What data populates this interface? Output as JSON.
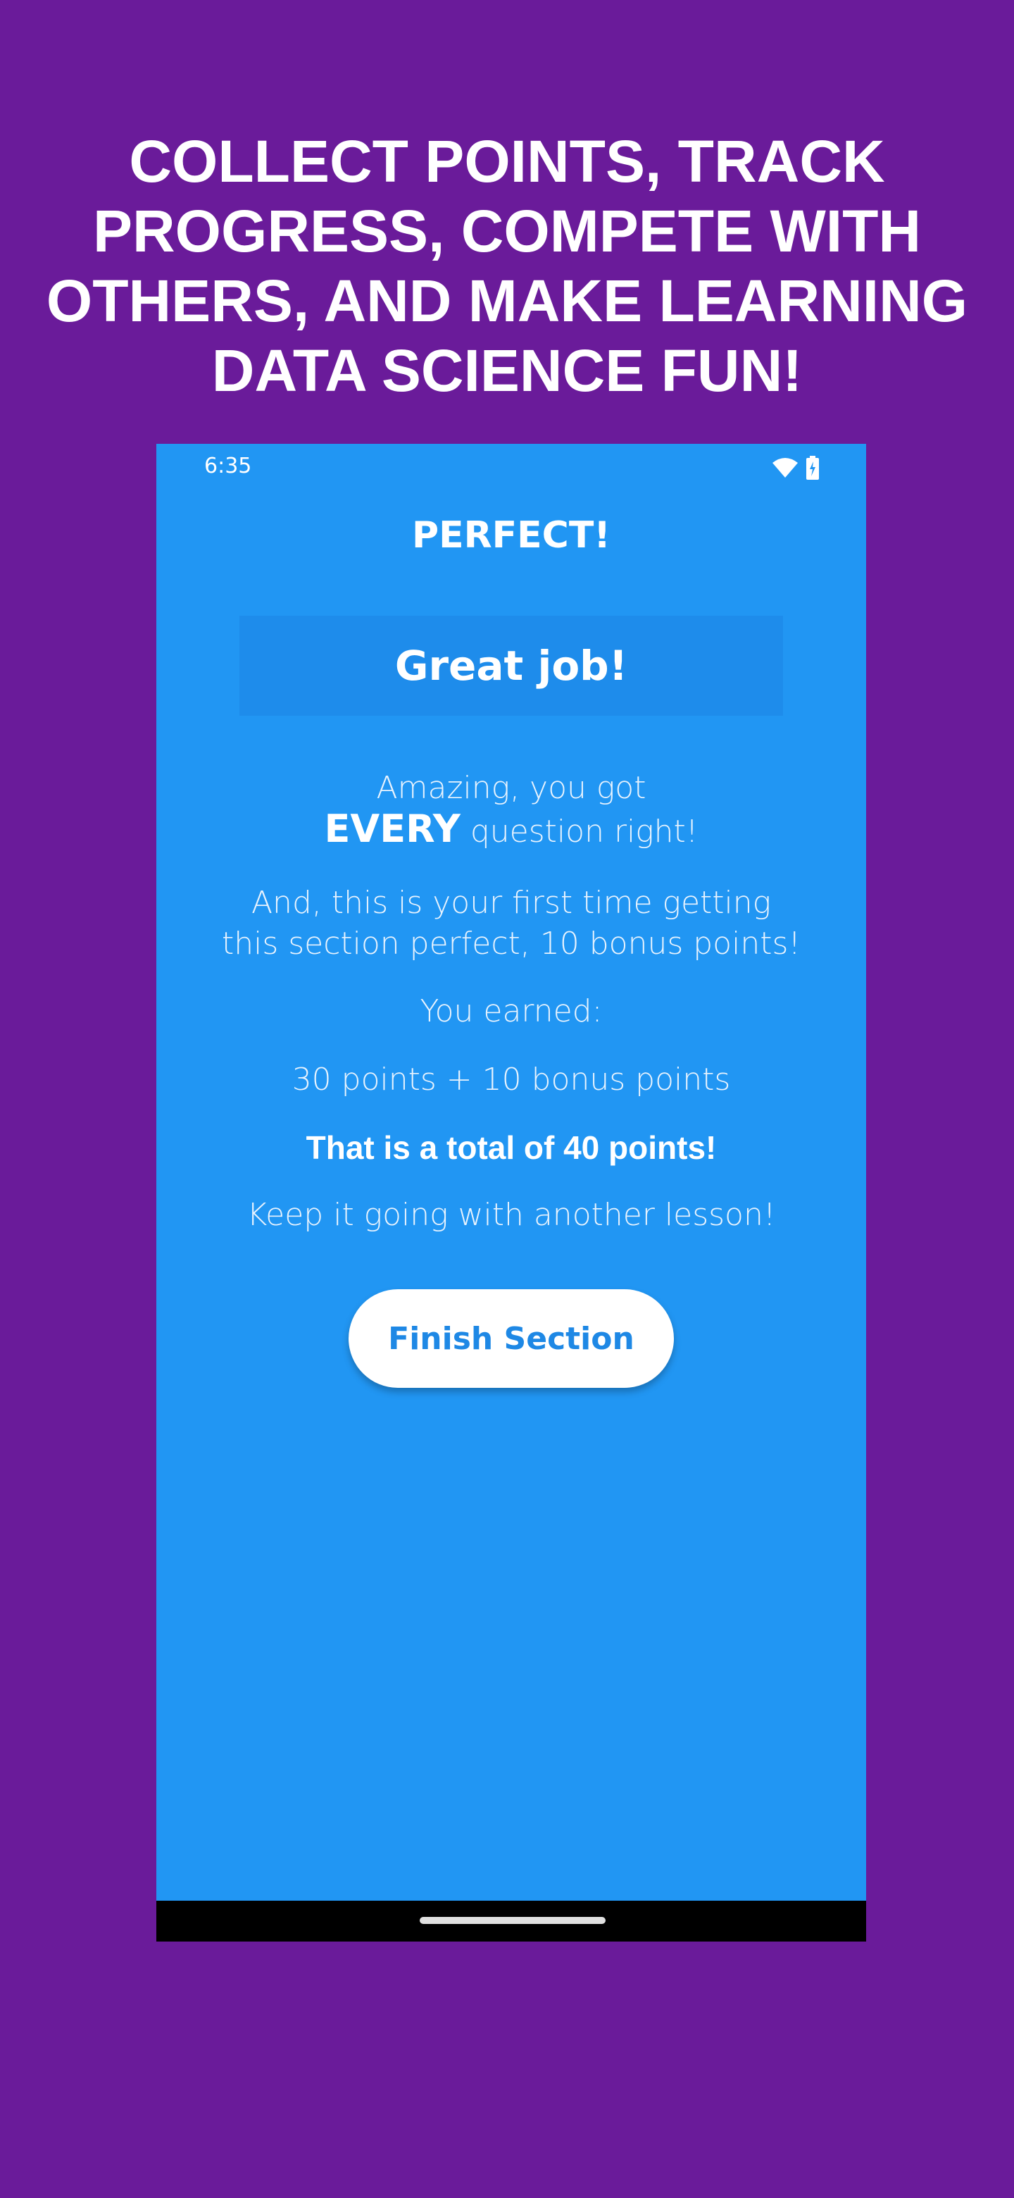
{
  "promo": {
    "headline_lines": [
      "COLLECT POINTS, TRACK",
      "PROGRESS, COMPETE WITH",
      "OTHERS, AND MAKE LEARNING",
      "DATA SCIENCE FUN!"
    ]
  },
  "status_bar": {
    "time": "6:35",
    "icons": [
      "wifi-icon",
      "battery-charging-icon"
    ]
  },
  "screen": {
    "title": "PERFECT!",
    "banner": "Great job!",
    "message": {
      "line1": "Amazing, you got",
      "line2_bold": "EVERY",
      "line2_rest": "question right!"
    },
    "bonus": {
      "line1": "And, this is your first time getting",
      "line2": "this section perfect, 10 bonus points!"
    },
    "earned_label": "You earned:",
    "points_breakdown": "30 points + 10 bonus points",
    "total": "That is a total of 40 points!",
    "encouragement": "Keep it going with another lesson!",
    "finish_button": "Finish Section"
  },
  "colors": {
    "background": "#6a1b9a",
    "screen": "#2196f3",
    "banner": "#1e8ceb",
    "button_text": "#1e88e5"
  }
}
